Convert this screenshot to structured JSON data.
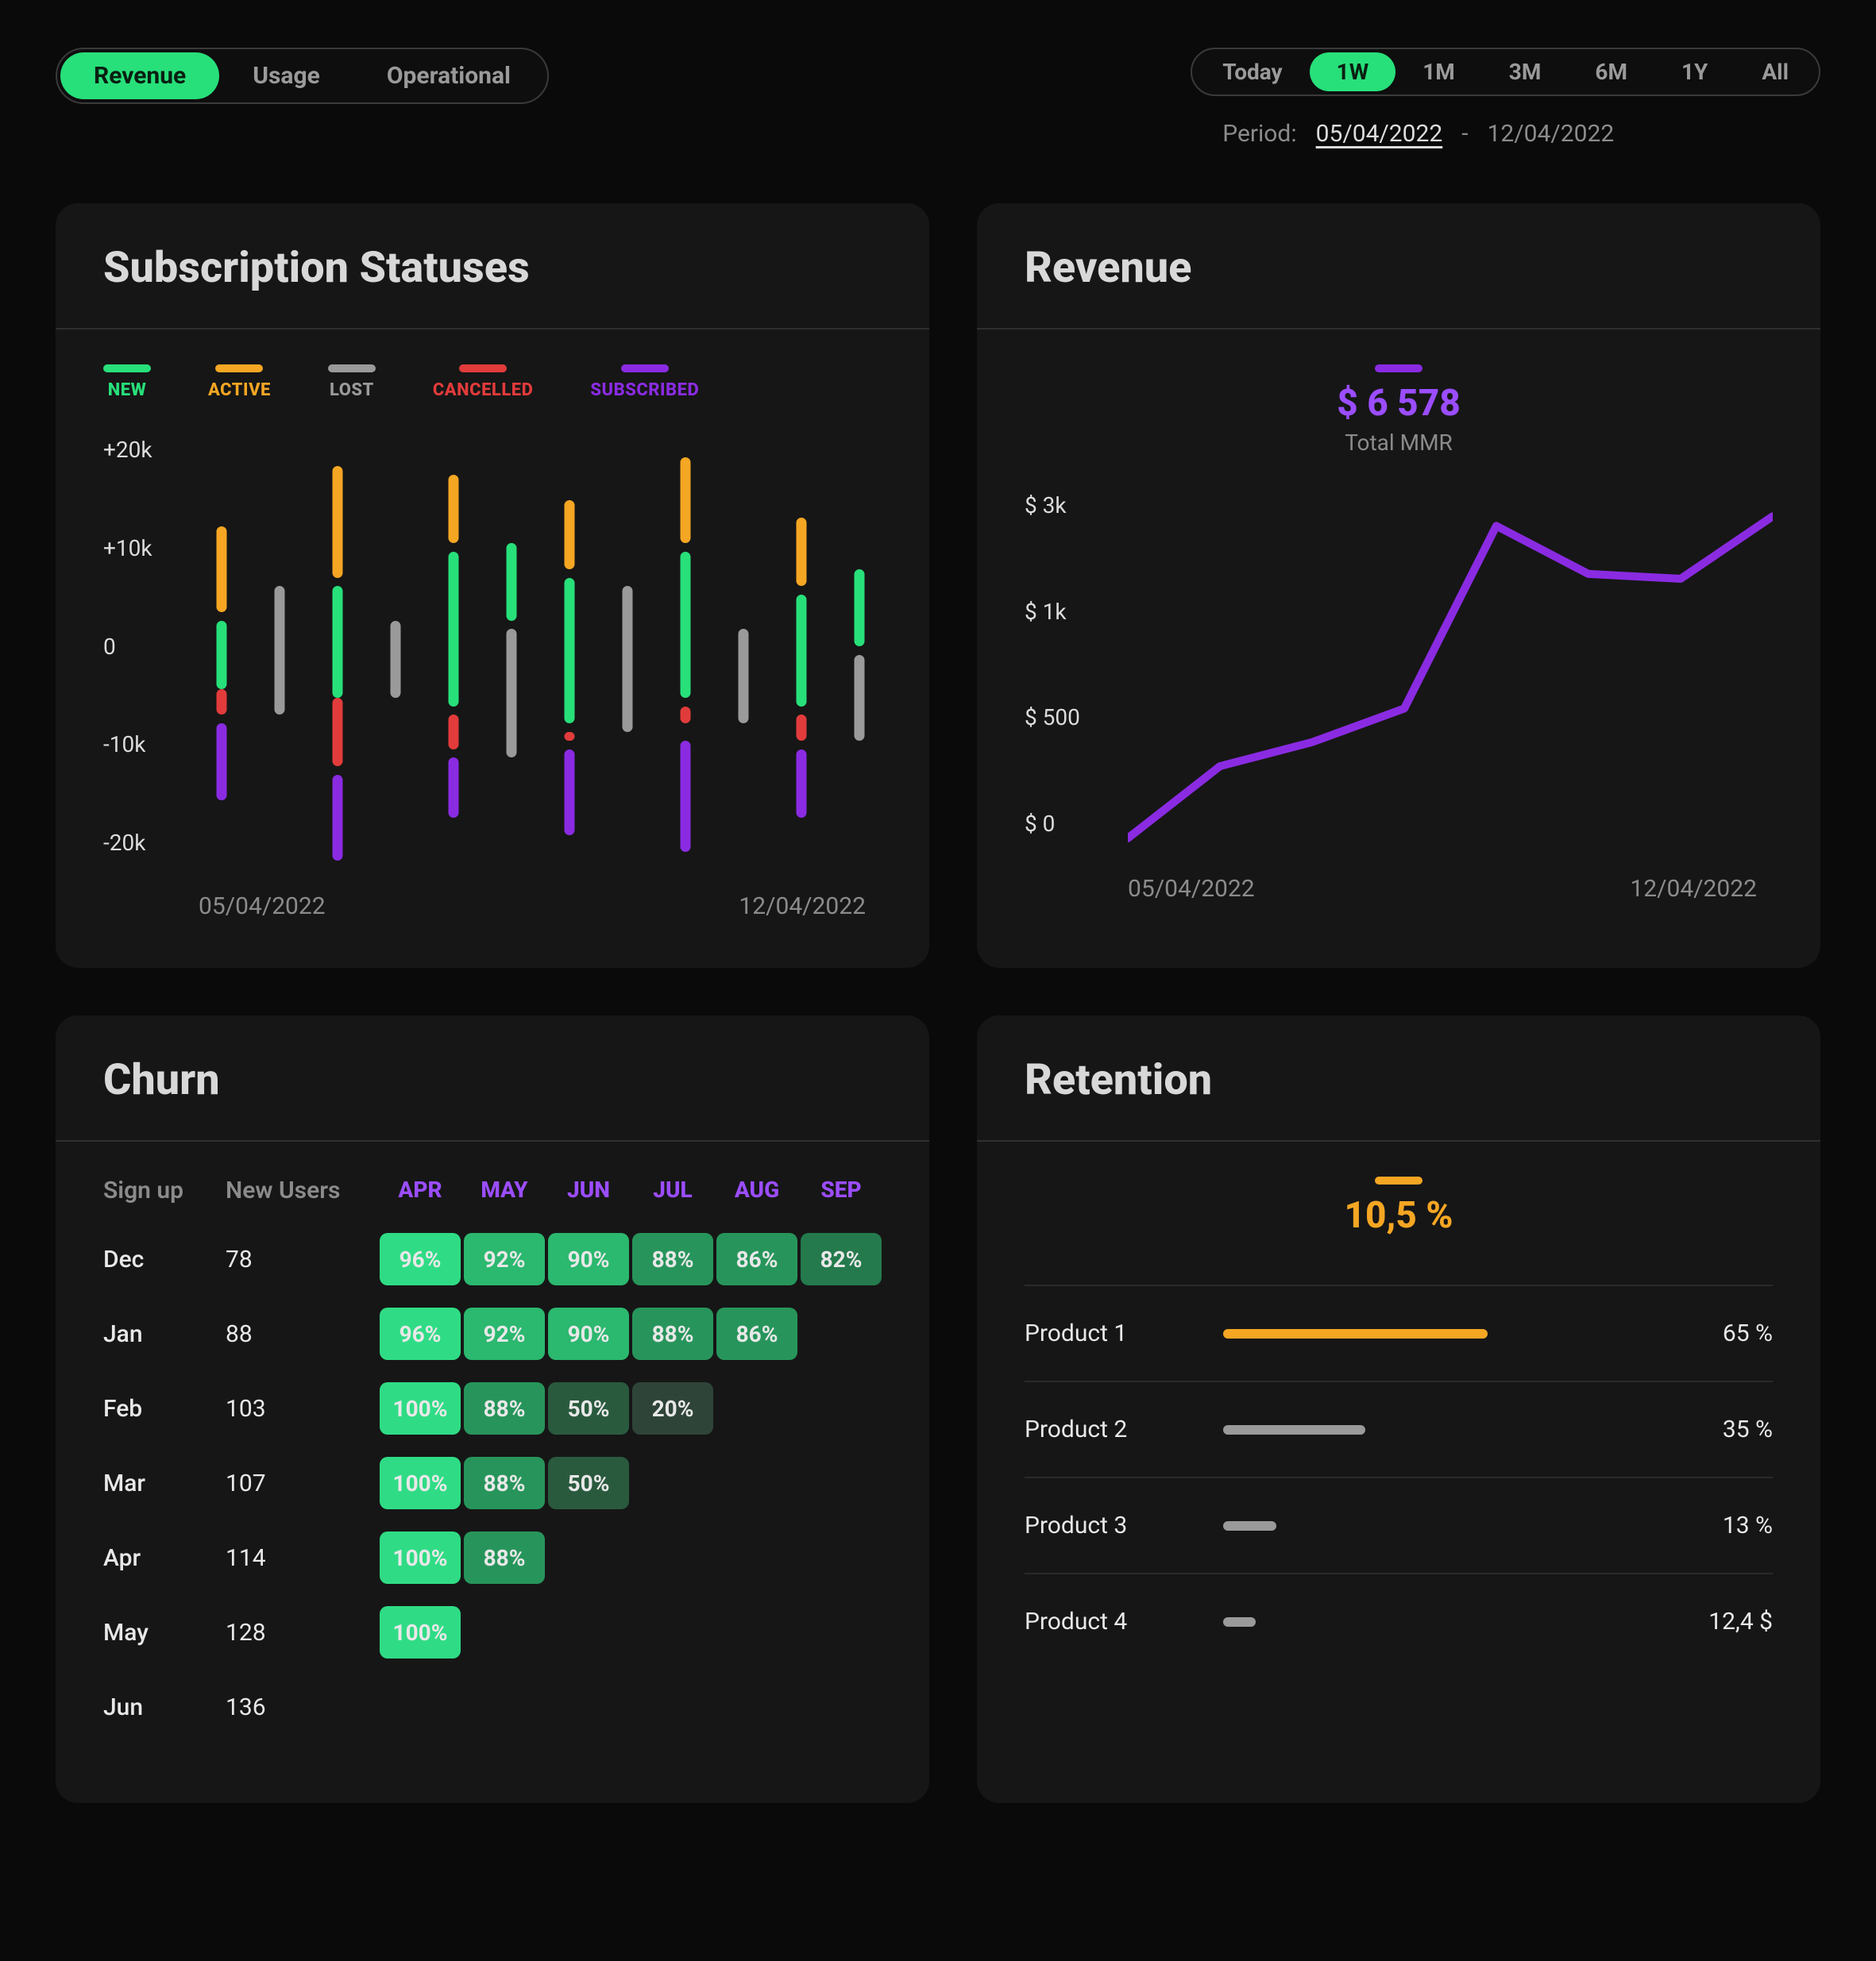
{
  "topTabs": {
    "items": [
      {
        "label": "Revenue",
        "active": true
      },
      {
        "label": "Usage",
        "active": false
      },
      {
        "label": "Operational",
        "active": false
      }
    ]
  },
  "rangeTabs": {
    "items": [
      {
        "label": "Today",
        "active": false
      },
      {
        "label": "1W",
        "active": true
      },
      {
        "label": "1M",
        "active": false
      },
      {
        "label": "3M",
        "active": false
      },
      {
        "label": "6M",
        "active": false
      },
      {
        "label": "1Y",
        "active": false
      },
      {
        "label": "All",
        "active": false
      }
    ]
  },
  "period": {
    "label": "Period:",
    "start": "05/04/2022",
    "sep": "-",
    "end": "12/04/2022"
  },
  "colors": {
    "new": "#27e07a",
    "active": "#f5a623",
    "lost": "#9a9a9a",
    "cancelled": "#e23b3b",
    "subscribed": "#8a2be2"
  },
  "subscriptionCard": {
    "title": "Subscription Statuses",
    "legend": [
      {
        "label": "NEW",
        "colorKey": "new"
      },
      {
        "label": "ACTIVE",
        "colorKey": "active"
      },
      {
        "label": "LOST",
        "colorKey": "lost"
      },
      {
        "label": "CANCELLED",
        "colorKey": "cancelled"
      },
      {
        "label": "SUBSCRIBED",
        "colorKey": "subscribed"
      }
    ],
    "yTicks": [
      "+20k",
      "+10k",
      "0",
      "-10k",
      "-20k"
    ],
    "xLabels": [
      "05/04/2022",
      "12/04/2022"
    ]
  },
  "revenueCard": {
    "title": "Revenue",
    "amount": "$ 6 578",
    "subtitle": "Total MMR",
    "yTicks": [
      "$ 3k",
      "$ 1k",
      "$ 500",
      "$ 0"
    ],
    "xLabels": [
      "05/04/2022",
      "12/04/2022"
    ]
  },
  "churnCard": {
    "title": "Churn",
    "headers": {
      "signup": "Sign up",
      "newUsers": "New Users"
    },
    "months": [
      "APR",
      "MAY",
      "JUN",
      "JUL",
      "AUG",
      "SEP"
    ],
    "rows": [
      {
        "label": "Dec",
        "users": "78",
        "cells": [
          "96%",
          "92%",
          "90%",
          "88%",
          "86%",
          "82%"
        ]
      },
      {
        "label": "Jan",
        "users": "88",
        "cells": [
          "96%",
          "92%",
          "90%",
          "88%",
          "86%"
        ]
      },
      {
        "label": "Feb",
        "users": "103",
        "cells": [
          "100%",
          "88%",
          "50%",
          "20%"
        ]
      },
      {
        "label": "Mar",
        "users": "107",
        "cells": [
          "100%",
          "88%",
          "50%"
        ]
      },
      {
        "label": "Apr",
        "users": "114",
        "cells": [
          "100%",
          "88%"
        ]
      },
      {
        "label": "May",
        "users": "128",
        "cells": [
          "100%"
        ]
      },
      {
        "label": "Jun",
        "users": "136",
        "cells": []
      }
    ]
  },
  "retentionCard": {
    "title": "Retention",
    "headline": "10,5 %",
    "rows": [
      {
        "label": "Product 1",
        "value": "65 %",
        "pct": 65,
        "color": "#f5a623"
      },
      {
        "label": "Product 2",
        "value": "35 %",
        "pct": 35,
        "color": "#9a9a9a"
      },
      {
        "label": "Product 3",
        "value": "13 %",
        "pct": 13,
        "color": "#9a9a9a"
      },
      {
        "label": "Product 4",
        "value": "12,4 $",
        "pct": 8,
        "color": "#9a9a9a"
      }
    ]
  },
  "chart_data": [
    {
      "type": "bar",
      "title": "Subscription Statuses",
      "ylabel": "",
      "ylim": [
        -20000,
        20000
      ],
      "x_range": [
        "05/04/2022",
        "12/04/2022"
      ],
      "note": "Each day renders two grouped stacks; segments span [low,high] in thousands.",
      "series_colors": {
        "new": "#27e07a",
        "active": "#f5a623",
        "lost": "#9a9a9a",
        "cancelled": "#e23b3b",
        "subscribed": "#8a2be2"
      },
      "columns": [
        {
          "group": 0,
          "stack": "a",
          "segments": [
            {
              "series": "active",
              "low": 4,
              "high": 14
            },
            {
              "series": "new",
              "low": -5,
              "high": 3
            },
            {
              "series": "cancelled",
              "low": -8,
              "high": -5
            },
            {
              "series": "subscribed",
              "low": -18,
              "high": -9
            }
          ]
        },
        {
          "group": 0,
          "stack": "b",
          "segments": [
            {
              "series": "lost",
              "low": -8,
              "high": 7
            }
          ]
        },
        {
          "group": 1,
          "stack": "a",
          "segments": [
            {
              "series": "active",
              "low": 8,
              "high": 21
            },
            {
              "series": "new",
              "low": -6,
              "high": 7
            },
            {
              "series": "cancelled",
              "low": -14,
              "high": -6
            },
            {
              "series": "subscribed",
              "low": -25,
              "high": -15
            }
          ]
        },
        {
          "group": 1,
          "stack": "b",
          "segments": [
            {
              "series": "lost",
              "low": -6,
              "high": 3
            }
          ]
        },
        {
          "group": 2,
          "stack": "a",
          "segments": [
            {
              "series": "active",
              "low": 12,
              "high": 20
            },
            {
              "series": "new",
              "low": -7,
              "high": 11
            },
            {
              "series": "cancelled",
              "low": -12,
              "high": -8
            },
            {
              "series": "subscribed",
              "low": -20,
              "high": -13
            }
          ]
        },
        {
          "group": 2,
          "stack": "b",
          "segments": [
            {
              "series": "new",
              "low": 3,
              "high": 12
            },
            {
              "series": "lost",
              "low": -13,
              "high": 2
            }
          ]
        },
        {
          "group": 3,
          "stack": "a",
          "segments": [
            {
              "series": "active",
              "low": 9,
              "high": 17
            },
            {
              "series": "new",
              "low": -9,
              "high": 8
            },
            {
              "series": "cancelled",
              "low": -11,
              "high": -10
            },
            {
              "series": "subscribed",
              "low": -22,
              "high": -12
            }
          ]
        },
        {
          "group": 3,
          "stack": "b",
          "segments": [
            {
              "series": "lost",
              "low": -10,
              "high": 7
            }
          ]
        },
        {
          "group": 4,
          "stack": "a",
          "segments": [
            {
              "series": "active",
              "low": 12,
              "high": 22
            },
            {
              "series": "new",
              "low": -6,
              "high": 11
            },
            {
              "series": "cancelled",
              "low": -9,
              "high": -7
            },
            {
              "series": "subscribed",
              "low": -24,
              "high": -11
            }
          ]
        },
        {
          "group": 4,
          "stack": "b",
          "segments": [
            {
              "series": "lost",
              "low": -9,
              "high": 2
            }
          ]
        },
        {
          "group": 5,
          "stack": "a",
          "segments": [
            {
              "series": "active",
              "low": 7,
              "high": 15
            },
            {
              "series": "new",
              "low": -7,
              "high": 6
            },
            {
              "series": "cancelled",
              "low": -11,
              "high": -8
            },
            {
              "series": "subscribed",
              "low": -20,
              "high": -12
            }
          ]
        },
        {
          "group": 5,
          "stack": "b",
          "segments": [
            {
              "series": "new",
              "low": 0,
              "high": 9
            },
            {
              "series": "lost",
              "low": -11,
              "high": -1
            }
          ]
        }
      ]
    },
    {
      "type": "line",
      "title": "Revenue",
      "ylabel": "$",
      "y_ticks": [
        0,
        500,
        1000,
        3000
      ],
      "x_range": [
        "05/04/2022",
        "12/04/2022"
      ],
      "series": [
        {
          "name": "Total MMR",
          "color": "#8a2be2",
          "x": [
            0,
            1,
            2,
            3,
            4,
            5,
            6,
            7
          ],
          "y": [
            -150,
            600,
            850,
            1200,
            3100,
            2600,
            2550,
            3200
          ]
        }
      ],
      "kpi": {
        "label": "Total MMR",
        "value": 6578,
        "display": "$ 6 578"
      }
    },
    {
      "type": "table",
      "title": "Churn",
      "columns": [
        "Sign up",
        "New Users",
        "APR",
        "MAY",
        "JUN",
        "JUL",
        "AUG",
        "SEP"
      ],
      "rows": [
        [
          "Dec",
          78,
          96,
          92,
          90,
          88,
          86,
          82
        ],
        [
          "Jan",
          88,
          96,
          92,
          90,
          88,
          86,
          null
        ],
        [
          "Feb",
          103,
          100,
          88,
          50,
          20,
          null,
          null
        ],
        [
          "Mar",
          107,
          100,
          88,
          50,
          null,
          null,
          null
        ],
        [
          "Apr",
          114,
          100,
          88,
          null,
          null,
          null,
          null
        ],
        [
          "May",
          128,
          100,
          null,
          null,
          null,
          null,
          null
        ],
        [
          "Jun",
          136,
          null,
          null,
          null,
          null,
          null,
          null
        ]
      ],
      "unit": "%"
    },
    {
      "type": "bar",
      "title": "Retention",
      "orientation": "horizontal",
      "kpi": {
        "display": "10,5 %"
      },
      "categories": [
        "Product 1",
        "Product 2",
        "Product 3",
        "Product 4"
      ],
      "values": [
        65,
        35,
        13,
        12.4
      ],
      "value_display": [
        "65 %",
        "35 %",
        "13 %",
        "12,4 $"
      ],
      "colors": [
        "#f5a623",
        "#9a9a9a",
        "#9a9a9a",
        "#9a9a9a"
      ]
    }
  ]
}
